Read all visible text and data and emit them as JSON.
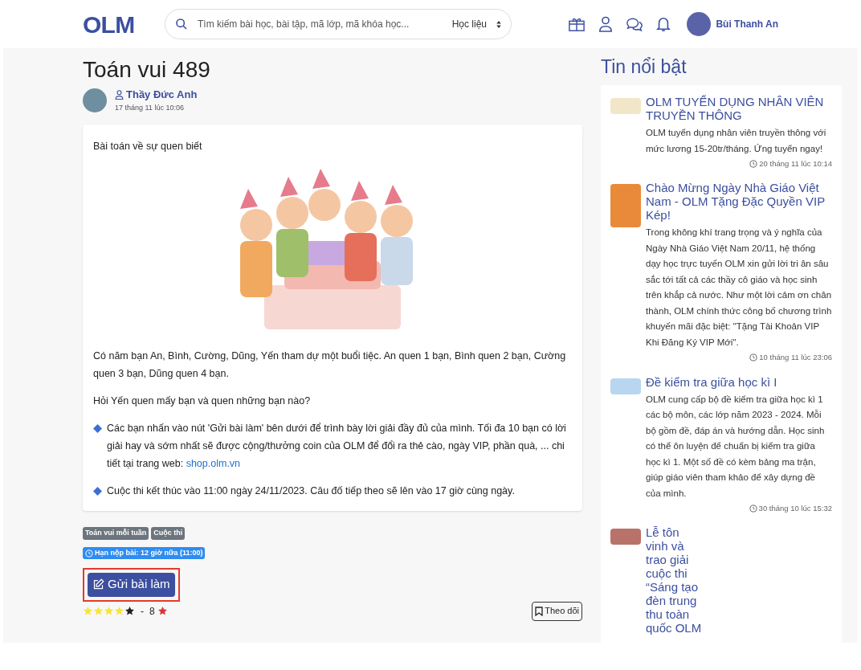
{
  "header": {
    "logo": "OLM",
    "search": {
      "placeholder": "Tìm kiếm bài học, bài tập, mã lớp, mã khóa học...",
      "filter": "Học liệu"
    },
    "user": {
      "name": "Bùi Thanh An"
    }
  },
  "post": {
    "title": "Toán vui 489",
    "author": "Thầy Đức Anh",
    "time": "17 tháng 11 lúc 10:06",
    "paragraphs": [
      {
        "kind": "heading",
        "text": "Bài toán về sự quen biết"
      },
      {
        "kind": "image"
      },
      {
        "kind": "text",
        "text": "Có năm bạn An, Bình, Cường, Dũng, Yến tham dự một buổi tiệc. An quen 1 bạn, Bình quen 2 bạn, Cường quen 3 bạn, Dũng quen 4 bạn."
      },
      {
        "kind": "text",
        "text": "Hỏi Yến quen mấy bạn và quen những bạn nào?"
      },
      {
        "kind": "bullet",
        "text": "Các bạn nhấn vào nút 'Gửi bài làm' bên dưới để trình bày lời giải đầy đủ của mình. Tối đa 10 bạn có lời giải hay và sớm nhất sẽ được cộng/thưởng coin của OLM để đổi ra thẻ cào, ngày VIP, phần quà, ... chi tiết tại trang web: ",
        "link": "shop.olm.vn"
      },
      {
        "kind": "bullet",
        "text": "Cuộc thi kết thúc vào 11:00 ngày 24/11/2023. Câu đố tiếp theo sẽ lên vào 17 giờ cùng ngày."
      }
    ],
    "tags": [
      "Toán vui mỗi tuần",
      "Cuộc thi"
    ],
    "deadline": "Hạn nộp bài: 12 giờ nữa (11:00)",
    "submit": {
      "label": "Gửi bài làm",
      "highlighted": true
    },
    "rating": {
      "stars": 4,
      "separator": "-",
      "count": "8"
    },
    "follow": "Theo dõi"
  },
  "news": {
    "title": "Tin nổi bật",
    "items": [
      {
        "title": "OLM TUYỂN DỤNG NHÂN VIÊN TRUYỀN THÔNG",
        "summary": "OLM tuyển dụng nhân viên truyền thông với mức lương 15-20tr/tháng. Ứng tuyển ngay!",
        "time": "20 tháng 11 lúc 10:14"
      },
      {
        "title": "Chào Mừng Ngày Nhà Giáo Việt Nam - OLM Tặng Đặc Quyền VIP Kép!",
        "summary": "Trong không khí trang trọng và ý nghĩa của Ngày Nhà Giáo Việt Nam 20/11, hệ thống dạy học trực tuyến OLM xin gửi lời tri ân sâu sắc tới tất cả các thầy cô giáo và học sinh trên khắp cả nước. Như một lời cảm ơn chân thành, OLM chính thức công bố chương trình khuyến mãi đặc biệt: \"Tặng Tài Khoản VIP Khi Đăng Ký VIP Mới\".",
        "time": "10 tháng 11 lúc 23:06"
      },
      {
        "title": "Đề kiểm tra giữa học kì I",
        "summary": "OLM cung cấp bộ đề kiểm tra giữa học kì 1 các bộ môn, các lớp năm 2023 - 2024. Mỗi bộ gồm đề, đáp án và hướng dẫn. Học sinh có thể ôn luyện để chuẩn bị kiểm tra giữa học kì 1. Một số đề có kèm bảng ma trận, giúp giáo viên tham khảo để xây dựng đề của mình.",
        "time": "30 tháng 10 lúc 15:32"
      },
      {
        "title": "Lễ tôn vinh và trao giải cuộc thi “Sáng tạo đèn trung thu toàn quốc OLM"
      }
    ]
  }
}
